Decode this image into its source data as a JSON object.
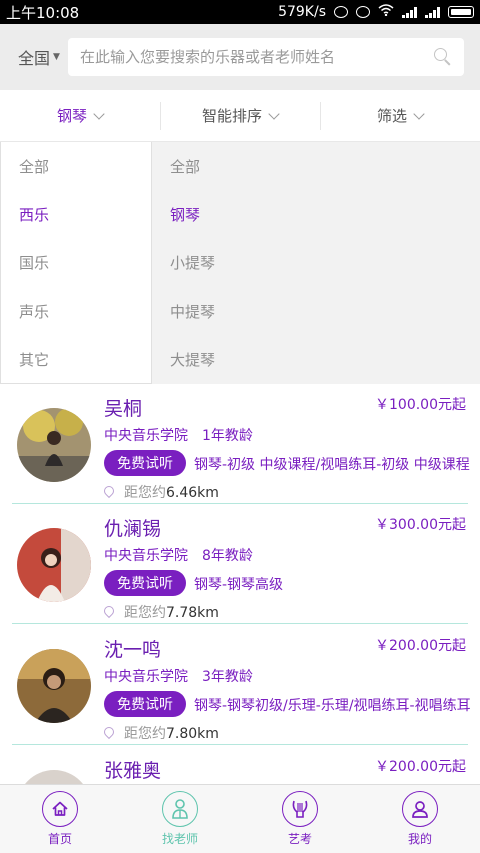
{
  "statusbar": {
    "time": "上午10:08",
    "speed": "579K/s"
  },
  "header": {
    "region": "全国",
    "search_placeholder": "在此输入您要搜索的乐器或者老师姓名"
  },
  "filters": [
    {
      "label": "钢琴",
      "active": true
    },
    {
      "label": "智能排序",
      "active": false
    },
    {
      "label": "筛选",
      "active": false
    }
  ],
  "dropdown": {
    "categories": [
      {
        "label": "全部",
        "active": false
      },
      {
        "label": "西乐",
        "active": true
      },
      {
        "label": "国乐",
        "active": false
      },
      {
        "label": "声乐",
        "active": false
      },
      {
        "label": "其它",
        "active": false
      }
    ],
    "instruments": [
      {
        "label": "全部",
        "active": false
      },
      {
        "label": "钢琴",
        "active": true
      },
      {
        "label": "小提琴",
        "active": false
      },
      {
        "label": "中提琴",
        "active": false
      },
      {
        "label": "大提琴",
        "active": false
      }
    ]
  },
  "teachers": [
    {
      "name": "吴桐",
      "price": "￥100.00元起",
      "school": "中央音乐学院",
      "years": "1年教龄",
      "trial": "免费试听",
      "courses": "钢琴-初级 中级课程/视唱练耳-初级 中级课程",
      "distance_prefix": "距您约",
      "distance": "6.46km"
    },
    {
      "name": "仇澜锡",
      "price": "￥300.00元起",
      "school": "中央音乐学院",
      "years": "8年教龄",
      "trial": "免费试听",
      "courses": "钢琴-钢琴高级",
      "distance_prefix": "距您约",
      "distance": "7.78km"
    },
    {
      "name": "沈一鸣",
      "price": "￥200.00元起",
      "school": "中央音乐学院",
      "years": "3年教龄",
      "trial": "免费试听",
      "courses": "钢琴-钢琴初级/乐理-乐理/视唱练耳-视唱练耳",
      "distance_prefix": "距您约",
      "distance": "7.80km"
    },
    {
      "name": "张雅奥",
      "price": "￥200.00元起"
    }
  ],
  "bottomnav": [
    {
      "label": "首页",
      "icon": "home-icon",
      "active": false
    },
    {
      "label": "找老师",
      "icon": "teacher-icon",
      "active": true
    },
    {
      "label": "艺考",
      "icon": "lyre-icon",
      "active": false
    },
    {
      "label": "我的",
      "icon": "user-icon",
      "active": false
    }
  ],
  "colors": {
    "accent": "#7a1fc0",
    "active_nav": "#5ec4ad",
    "divider": "#b5e7dd"
  }
}
